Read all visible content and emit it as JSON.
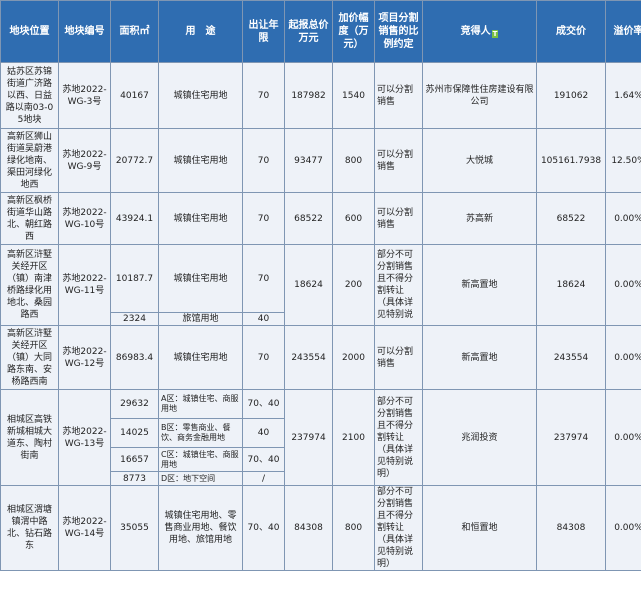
{
  "headers": {
    "location": "地块位置",
    "code": "地块编号",
    "area": "面积㎡",
    "usage": "用　途",
    "term": "出让年限",
    "start_price": "起报总价万元",
    "increment": "加价幅度（万元）",
    "ratio": "项目分割销售的比例约定",
    "winner": "竞得人",
    "deal_price": "成交价",
    "premium": "溢价率",
    "tag": "T"
  },
  "rows": {
    "r1": {
      "location": "姑苏区苏锦街道广济路以西、日益路以南03-05地块",
      "code": "苏地2022-WG-3号",
      "area": "40167",
      "usage": "城镇住宅用地",
      "term": "70",
      "start": "187982",
      "inc": "1540",
      "ratio": "可以分割销售",
      "winner": "苏州市保障性住房建设有限公司",
      "deal": "191062",
      "premium": "1.64%"
    },
    "r2": {
      "location": "高新区狮山街道吴蔚港绿化地南、渠田河绿化地西",
      "code": "苏地2022-WG-9号",
      "area": "20772.7",
      "usage": "城镇住宅用地",
      "term": "70",
      "start": "93477",
      "inc": "800",
      "ratio": "可以分割销售",
      "winner": "大悦城",
      "deal": "105161.7938",
      "premium": "12.50%"
    },
    "r3": {
      "location": "高新区枫桥街道华山路北、朝红路西",
      "code": "苏地2022-WG-10号",
      "area": "43924.1",
      "usage": "城镇住宅用地",
      "term": "70",
      "start": "68522",
      "inc": "600",
      "ratio": "可以分割销售",
      "winner": "苏高新",
      "deal": "68522",
      "premium": "0.00%"
    },
    "r4": {
      "location": "高新区浒墅关经开区（镇）南津桥路绿化用地北、桑园路西",
      "code": "苏地2022-WG-11号",
      "area": "10187.7",
      "area2": "2324",
      "usage": "城镇住宅用地",
      "usage2": "旅馆用地",
      "term": "70",
      "term2": "40",
      "start": "18624",
      "inc": "200",
      "ratio": "部分不可分割销售且不得分割转让（具体详见特别说",
      "winner": "新高置地",
      "deal": "18624",
      "premium": "0.00%"
    },
    "r5": {
      "location": "高新区浒墅关经开区（镇）大同路东南、安杨路西南",
      "code": "苏地2022-WG-12号",
      "area": "86983.4",
      "usage": "城镇住宅用地",
      "term": "70",
      "start": "243554",
      "inc": "2000",
      "ratio": "可以分割销售",
      "winner": "新高置地",
      "deal": "243554",
      "premium": "0.00%"
    },
    "r6": {
      "location": "相城区高铁新城相城大道东、陶村街南",
      "code": "苏地2022-WG-13号",
      "areas": [
        "29632",
        "14025",
        "16657",
        "8773"
      ],
      "usages": [
        "A区：城镇住宅、商服用地",
        "B区：零售商业、餐饮、商务金融用地",
        "C区：城镇住宅、商服用地",
        "D区：地下空间"
      ],
      "terms": [
        "70、40",
        "40",
        "70、40",
        "/"
      ],
      "start": "237974",
      "inc": "2100",
      "ratio": "部分不可分割销售且不得分割转让（具体详见特别说明）",
      "winner": "兆润投资",
      "deal": "237974",
      "premium": "0.00%"
    },
    "r7": {
      "location": "相城区渭塘镇渭中路北、钻石路东",
      "code": "苏地2022-WG-14号",
      "area": "35055",
      "usage": "城镇住宅用地、零售商业用地、餐饮用地、旅馆用地",
      "term": "70、40",
      "start": "84308",
      "inc": "800",
      "ratio": "部分不可分割销售且不得分割转让（具体详见特别说明）",
      "winner": "和恒置地",
      "deal": "84308",
      "premium": "0.00%"
    }
  }
}
